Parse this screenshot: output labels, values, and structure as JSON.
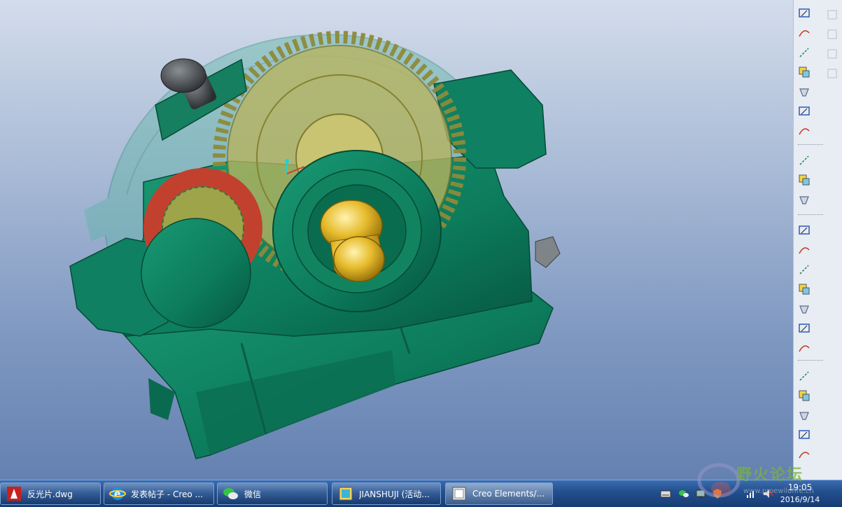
{
  "app": {
    "name": "Creo Elements/Pro"
  },
  "viewport": {
    "background_top": "#d3dceb",
    "background_bottom": "#6481b1",
    "model_color": "#0e7a5c",
    "gear_color": "#b7b35a",
    "shaft_color": "#e1b72a",
    "pinion_ring_color": "#c2412e"
  },
  "toolbar": {
    "icons": [
      "sketch-curve-icon",
      "datum-plane-icon",
      "datum-axis-icon",
      "datum-curve-icon",
      "datum-point-icon",
      "datum-csys-icon",
      "analysis-icon",
      "extrude-icon",
      "revolve-icon",
      "sweep-icon",
      "hole-icon",
      "shell-icon",
      "rib-icon",
      "draft-icon",
      "round-icon",
      "chamfer-icon",
      "blend-icon",
      "pattern-icon",
      "mirror-icon",
      "offset-icon",
      "thicken-icon",
      "solidify-icon"
    ],
    "secondary_icons": [
      "copy-icon",
      "paste-icon",
      "select-icon",
      "filter-icon"
    ]
  },
  "taskbar": {
    "tasks": [
      {
        "label": "反光片.dwg",
        "icon": "autocad-icon"
      },
      {
        "label": "发表帖子 - Creo ...",
        "icon": "ie-icon"
      },
      {
        "label": "微信",
        "icon": "wechat-icon"
      },
      {
        "label": "JIANSHUJI (活动...",
        "icon": "creo-window-icon"
      },
      {
        "label": "Creo Elements/...",
        "icon": "creo-app-icon"
      }
    ],
    "tray_icons": [
      "keyboard-icon",
      "wechat-tray-icon",
      "network-icon",
      "shield-icon",
      "signal-icon",
      "volume-muted-icon"
    ],
    "time": "19:05",
    "date": "2016/9/14"
  },
  "watermark": {
    "text": "野火论坛",
    "sub": "www.proewildfire.cn"
  }
}
